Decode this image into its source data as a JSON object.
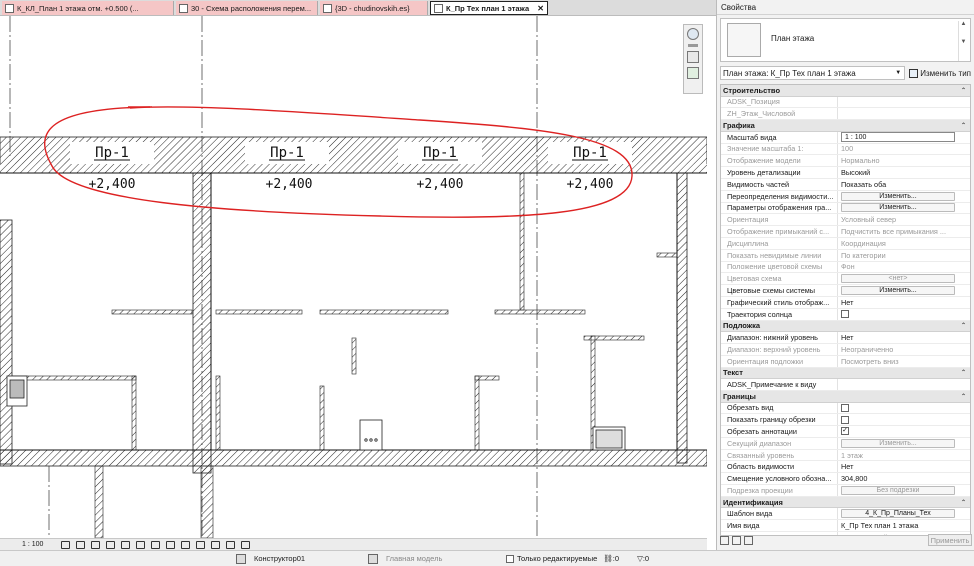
{
  "tabs": [
    {
      "label": "К_КЛ_План 1 этажа  отм. +0.500 (...",
      "style": "pink"
    },
    {
      "label": "30 - Схема расположения перем...",
      "style": "pink"
    },
    {
      "label": "{3D - chudinovskih.es}",
      "style": "pink"
    },
    {
      "label": "К_Пр Тех план 1 этажа",
      "style": "active"
    }
  ],
  "drawing": {
    "tags": [
      "Пр-1",
      "Пр-1",
      "Пр-1",
      "Пр-1"
    ],
    "elevations": [
      "+2,400",
      "+2,400",
      "+2,400",
      "+2,400"
    ]
  },
  "view_bar": {
    "scale": "1 : 100"
  },
  "status_bar": {
    "workset": "Конструктор01",
    "design_option": "Главная модель",
    "editable_only": "Только редактируемые",
    "count_a": ":0",
    "count_b": ":0",
    "filter_count": ":0"
  },
  "properties": {
    "title": "Свойства",
    "type_name": "План этажа",
    "instance_selector": "План этажа: К_Пр Тех план 1 этажа",
    "edit_type": "Изменить тип",
    "apply": "Применить",
    "groups": [
      {
        "name": "Строительство",
        "rows": [
          {
            "name": "ADSK_Позиция",
            "value": "",
            "kind": "text",
            "disabled": true
          },
          {
            "name": "ZH_Этаж_Числовой",
            "value": "",
            "kind": "text",
            "disabled": true
          }
        ]
      },
      {
        "name": "Графика",
        "rows": [
          {
            "name": "Масштаб вида",
            "value": "1 : 100",
            "kind": "input",
            "disabled": false
          },
          {
            "name": "Значение масштаба    1:",
            "value": "100",
            "kind": "text",
            "disabled": true
          },
          {
            "name": "Отображение модели",
            "value": "Нормально",
            "kind": "text",
            "disabled": true
          },
          {
            "name": "Уровень детализации",
            "value": "Высокий",
            "kind": "text",
            "disabled": false
          },
          {
            "name": "Видимость частей",
            "value": "Показать оба",
            "kind": "text",
            "disabled": false
          },
          {
            "name": "Переопределения видимости...",
            "value": "Изменить...",
            "kind": "button",
            "disabled": false
          },
          {
            "name": "Параметры отображения гра...",
            "value": "Изменить...",
            "kind": "button",
            "disabled": false
          },
          {
            "name": "Ориентация",
            "value": "Условный север",
            "kind": "text",
            "disabled": true
          },
          {
            "name": "Отображение примыканий с...",
            "value": "Подчистить все примыкания ...",
            "kind": "text",
            "disabled": true
          },
          {
            "name": "Дисциплина",
            "value": "Координация",
            "kind": "text",
            "disabled": true
          },
          {
            "name": "Показать невидимые линии",
            "value": "По категории",
            "kind": "text",
            "disabled": true
          },
          {
            "name": "Положение цветовой схемы",
            "value": "Фон",
            "kind": "text",
            "disabled": true
          },
          {
            "name": "Цветовая схема",
            "value": "<нет>",
            "kind": "button",
            "disabled": true
          },
          {
            "name": "Цветовые схемы системы",
            "value": "Изменить...",
            "kind": "button",
            "disabled": false
          },
          {
            "name": "Графический стиль отображ...",
            "value": "Нет",
            "kind": "text",
            "disabled": false
          },
          {
            "name": "Траектория солнца",
            "value": "",
            "kind": "check",
            "checked": false,
            "disabled": false
          }
        ]
      },
      {
        "name": "Подложка",
        "rows": [
          {
            "name": "Диапазон: нижний уровень",
            "value": "Нет",
            "kind": "text",
            "disabled": false
          },
          {
            "name": "Диапазон: верхний уровень",
            "value": "Неограниченно",
            "kind": "text",
            "disabled": true
          },
          {
            "name": "Ориентация подложки",
            "value": "Посмотреть вниз",
            "kind": "text",
            "disabled": true
          }
        ]
      },
      {
        "name": "Текст",
        "rows": [
          {
            "name": "ADSK_Примечание к виду",
            "value": "",
            "kind": "text",
            "disabled": false
          }
        ]
      },
      {
        "name": "Границы",
        "rows": [
          {
            "name": "Обрезать вид",
            "value": "",
            "kind": "check",
            "checked": false,
            "disabled": false
          },
          {
            "name": "Показать границу обрезки",
            "value": "",
            "kind": "check",
            "checked": false,
            "disabled": false
          },
          {
            "name": "Обрезать аннотации",
            "value": "",
            "kind": "check",
            "checked": true,
            "disabled": false
          },
          {
            "name": "Секущий диапазон",
            "value": "Изменить...",
            "kind": "button",
            "disabled": true
          },
          {
            "name": "Связанный уровень",
            "value": "1 этаж",
            "kind": "text",
            "disabled": true
          },
          {
            "name": "Область видимости",
            "value": "Нет",
            "kind": "text",
            "disabled": false
          },
          {
            "name": "Смещение условного обозна...",
            "value": "304,800",
            "kind": "text",
            "disabled": false
          },
          {
            "name": "Подрезка проекции",
            "value": "Без подрезки",
            "kind": "button",
            "disabled": true
          }
        ]
      },
      {
        "name": "Идентификация",
        "rows": [
          {
            "name": "Шаблон вида",
            "value": "4_К_Пр_Планы_Тех",
            "kind": "button",
            "disabled": false
          },
          {
            "name": "Имя вида",
            "value": "К_Пр Тех план 1 этажа",
            "kind": "text",
            "disabled": false
          },
          {
            "name": "Зависимость вида",
            "value": "Независимый",
            "kind": "text",
            "disabled": true
          }
        ]
      }
    ]
  }
}
